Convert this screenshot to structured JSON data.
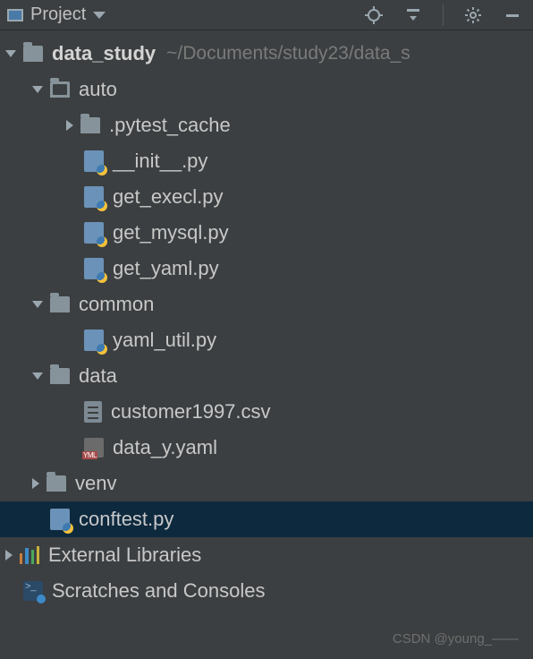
{
  "toolbar": {
    "title": "Project"
  },
  "tree": {
    "root": {
      "name": "data_study",
      "path": "~/Documents/study23/data_s"
    },
    "auto": {
      "name": "auto"
    },
    "pytest_cache": {
      "name": ".pytest_cache"
    },
    "init_py": {
      "name": "__init__.py"
    },
    "get_execl": {
      "name": "get_execl.py"
    },
    "get_mysql": {
      "name": "get_mysql.py"
    },
    "get_yaml": {
      "name": "get_yaml.py"
    },
    "common": {
      "name": "common"
    },
    "yaml_util": {
      "name": "yaml_util.py"
    },
    "data": {
      "name": "data"
    },
    "customer_csv": {
      "name": "customer1997.csv"
    },
    "data_yaml": {
      "name": "data_y.yaml"
    },
    "venv": {
      "name": "venv"
    },
    "conftest": {
      "name": "conftest.py"
    },
    "external": {
      "name": "External Libraries"
    },
    "scratches": {
      "name": "Scratches and Consoles"
    }
  },
  "watermark": "CSDN @young_——"
}
